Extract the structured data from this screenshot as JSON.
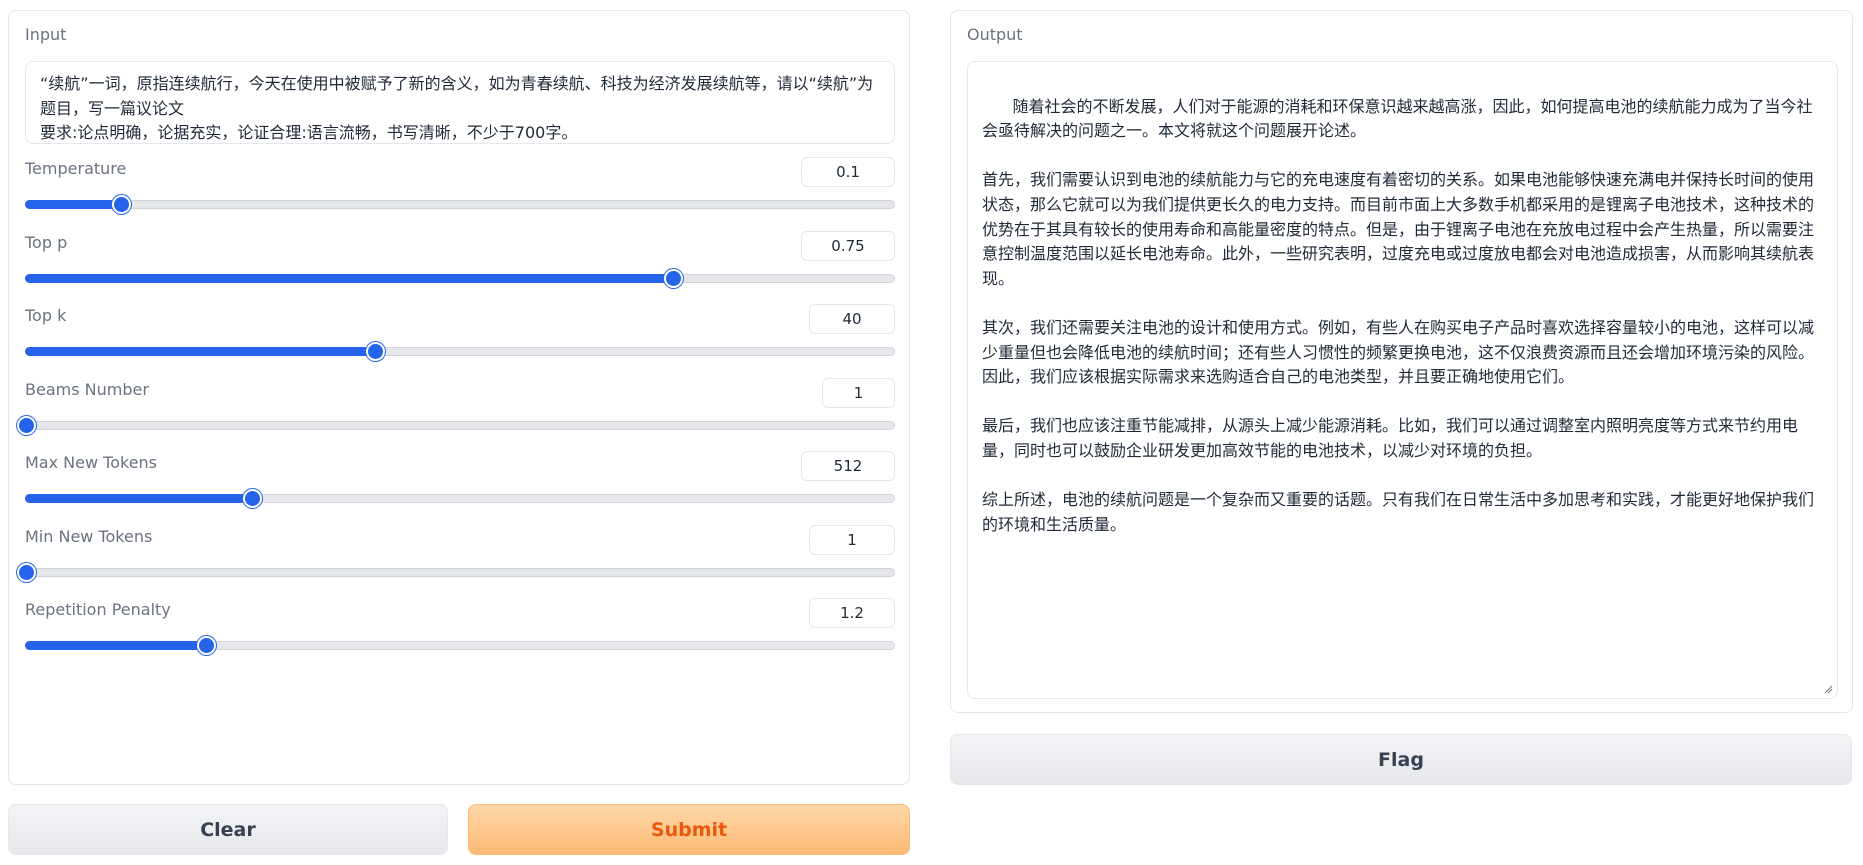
{
  "input": {
    "label": "Input",
    "value": "“续航”一词，原指连续航行，今天在使用中被赋予了新的含义，如为青春续航、科技为经济发展续航等，请以“续航”为题目，写一篇议论文\n要求:论点明确，论据充实，论证合理:语言流畅，书写清晰，不少于700字。"
  },
  "params": [
    {
      "label": "Temperature",
      "value": "0.1",
      "fraction": 0.109
    },
    {
      "label": "Top p",
      "value": "0.75",
      "fraction": 0.745
    },
    {
      "label": "Top k",
      "value": "40",
      "fraction": 0.402
    },
    {
      "label": "Beams Number",
      "value": "1",
      "fraction": 0.0
    },
    {
      "label": "Max New Tokens",
      "value": "512",
      "fraction": 0.26
    },
    {
      "label": "Min New Tokens",
      "value": "1",
      "fraction": 0.0
    },
    {
      "label": "Repetition Penalty",
      "value": "1.2",
      "fraction": 0.207
    }
  ],
  "buttons": {
    "clear": "Clear",
    "submit": "Submit",
    "flag": "Flag"
  },
  "output": {
    "label": "Output",
    "value": "随着社会的不断发展，人们对于能源的消耗和环保意识越来越高涨，因此，如何提高电池的续航能力成为了当今社会亟待解决的问题之一。本文将就这个问题展开论述。\n\n首先，我们需要认识到电池的续航能力与它的充电速度有着密切的关系。如果电池能够快速充满电并保持长时间的使用状态，那么它就可以为我们提供更长久的电力支持。而目前市面上大多数手机都采用的是锂离子电池技术，这种技术的优势在于其具有较长的使用寿命和高能量密度的特点。但是，由于锂离子电池在充放电过程中会产生热量，所以需要注意控制温度范围以延长电池寿命。此外，一些研究表明，过度充电或过度放电都会对电池造成损害，从而影响其续航表现。\n\n其次，我们还需要关注电池的设计和使用方式。例如，有些人在购买电子产品时喜欢选择容量较小的电池，这样可以减少重量但也会降低电池的续航时间；还有些人习惯性的频繁更换电池，这不仅浪费资源而且还会增加环境污染的风险。因此，我们应该根据实际需求来选购适合自己的电池类型，并且要正确地使用它们。\n\n最后，我们也应该注重节能减排，从源头上减少能源消耗。比如，我们可以通过调整室内照明亮度等方式来节约用电量，同时也可以鼓励企业研发更加高效节能的电池技术，以减少对环境的负担。\n\n综上所述，电池的续航问题是一个复杂而又重要的话题。只有我们在日常生活中多加思考和实践，才能更好地保护我们的环境和生活质量。"
  },
  "colors": {
    "accent": "#2563eb",
    "submit_text": "#ea580c",
    "submit_bg": "#fdba74"
  }
}
